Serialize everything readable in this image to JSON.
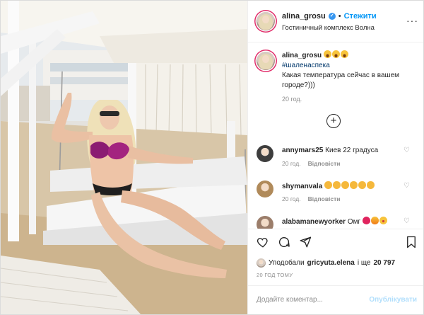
{
  "post": {
    "author": "alina_grosu",
    "follow_label": "Стежити",
    "separator": "•",
    "location": "Гостиничный комплекс Волна",
    "more_label": "···"
  },
  "caption": {
    "user": "alina_grosu",
    "hashtag": "#шаленаспека",
    "text": "Какая температура сейчас в вашем городе?)))",
    "time": "20 год."
  },
  "load_more_label": "+",
  "comments": [
    {
      "user": "annymars25",
      "text": "Киев 22 градуса",
      "time": "20 год.",
      "reply": "Відповісти"
    },
    {
      "user": "shymanvala",
      "text": "",
      "time": "20 год.",
      "reply": "Відповісти"
    },
    {
      "user": "alabamanewyorker",
      "text": "Омг",
      "time": "",
      "reply": ""
    }
  ],
  "likes": {
    "prefix": "Уподобали",
    "user": "gricyuta.elena",
    "middle": "і ще",
    "count": "20 797"
  },
  "post_time": "20 ГОД ТОМУ",
  "add_comment": {
    "placeholder": "Додайте коментар...",
    "publish_label": "Опублікувати"
  },
  "colors": {
    "accent": "#0095f6",
    "publish_disabled": "#b2dffc",
    "muted": "#8e8e8e",
    "text": "#262626"
  },
  "icons": [
    "verified-icon",
    "more-icon",
    "add-circle-icon",
    "heart-icon",
    "comment-icon",
    "share-icon",
    "bookmark-icon"
  ]
}
